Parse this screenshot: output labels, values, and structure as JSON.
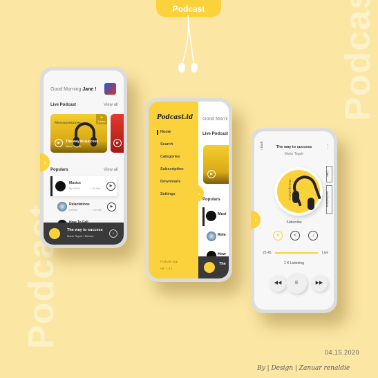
{
  "colors": {
    "background": "#fbe6a4",
    "accent": "#fcd23c",
    "dark": "#3a3a3a"
  },
  "header_tab": "Podcast",
  "background_words": [
    "Podcast",
    "Podcast"
  ],
  "phone_home": {
    "greeting": "Good Morning",
    "user": "Jane !",
    "live_title": "Live Podcast",
    "live_view_all": "View all",
    "live_card": {
      "brand": "Mousquetaires",
      "badge_count": "1k",
      "badge_label": "Listen",
      "title": "The way to success",
      "author": "Mario Teguh"
    },
    "populars_title": "Populars",
    "populars_view_all": "View all",
    "populars": [
      {
        "title": "Musics",
        "author": "By VIVID",
        "duration": "• 33 Min"
      },
      {
        "title": "Relactations",
        "author": "Celline",
        "duration": "• 12 Min"
      },
      {
        "title": "How To Fall",
        "author": "",
        "duration": ""
      }
    ],
    "now_playing": {
      "title": "The way to success",
      "subtitle": "Mario Teguh • Stream"
    }
  },
  "phone_menu": {
    "logo": "Podcast.id",
    "items": [
      "Home",
      "Search",
      "Categories",
      "Subscription",
      "Downloads",
      "Settings"
    ],
    "active": "Home",
    "footer_app": "Podcast App",
    "footer_version": "Ver 1.0.1",
    "peek_greeting": "Good Morni",
    "peek_live": "Live Podcast",
    "peek_populars": "Populars",
    "peek_items": [
      "Musi",
      "Rela",
      "How"
    ],
    "peek_player": "The"
  },
  "phone_player": {
    "back": "Back",
    "title": "The way to success",
    "author": "Mario Teguh",
    "tags": [
      "Live",
      "Motivations"
    ],
    "cover_brand": "Mousquetaires",
    "subscribe": "Subscribe",
    "elapsed": "25.45",
    "live": "Live",
    "progress": 0.95,
    "listening": "1 K Listening"
  },
  "footer": {
    "date": "04.15.2020",
    "signature": "By | Design | Zanuar renaldie"
  }
}
